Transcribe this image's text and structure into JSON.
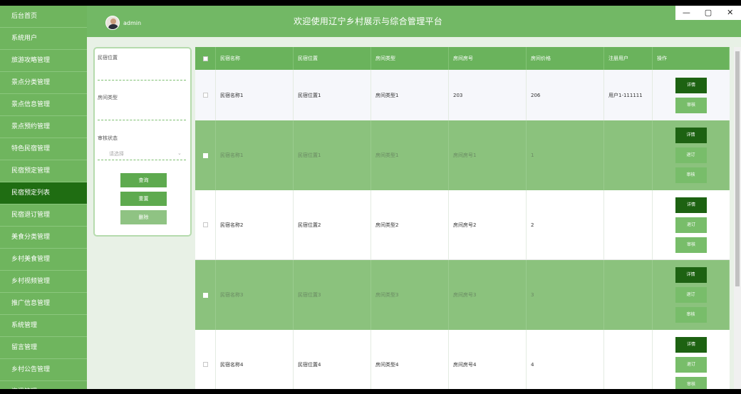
{
  "window_controls": {
    "minimize": "—",
    "maximize": "▢",
    "close": "✕"
  },
  "sidebar": {
    "items": [
      {
        "label": "后台首页"
      },
      {
        "label": "系统用户"
      },
      {
        "label": "旅游攻略管理"
      },
      {
        "label": "景点分类管理"
      },
      {
        "label": "景点信息管理"
      },
      {
        "label": "景点预约管理"
      },
      {
        "label": "特色民宿管理"
      },
      {
        "label": "民宿预定管理"
      },
      {
        "label": "民宿预定列表"
      },
      {
        "label": "民宿退订管理"
      },
      {
        "label": "美食分类管理"
      },
      {
        "label": "乡村美食管理"
      },
      {
        "label": "乡村视频管理"
      },
      {
        "label": "推广信息管理"
      },
      {
        "label": "系统管理"
      },
      {
        "label": "留言管理"
      },
      {
        "label": "乡村公告管理"
      },
      {
        "label": "资讯管理"
      }
    ],
    "active_index": 8
  },
  "header": {
    "username": "admin",
    "title": "欢迎使用辽宁乡村展示与综合管理平台"
  },
  "filter": {
    "location_label": "民宿位置",
    "room_type_label": "房间类型",
    "status_label": "审核状态",
    "status_placeholder": "请选择",
    "query_button": "查询",
    "reset_button": "重置",
    "delete_button": "删除"
  },
  "table": {
    "columns": [
      "民宿名称",
      "民宿位置",
      "房间类型",
      "房间房号",
      "房间价格",
      "注册用户",
      "操作"
    ],
    "rows": [
      {
        "name": "民宿名称1",
        "location": "民宿位置1",
        "room_type": "房间类型1",
        "room_no": "203",
        "price": "206",
        "user": "用户1-111111",
        "actions": [
          "详情",
          "审核"
        ]
      },
      {
        "name": "民宿名称1",
        "location": "民宿位置1",
        "room_type": "房间类型1",
        "room_no": "房间房号1",
        "price": "1",
        "user": "",
        "actions": [
          "详情",
          "退订",
          "审核"
        ]
      },
      {
        "name": "民宿名称2",
        "location": "民宿位置2",
        "room_type": "房间类型2",
        "room_no": "房间房号2",
        "price": "2",
        "user": "",
        "actions": [
          "详情",
          "退订",
          "审核"
        ]
      },
      {
        "name": "民宿名称3",
        "location": "民宿位置3",
        "room_type": "房间类型3",
        "room_no": "房间房号3",
        "price": "3",
        "user": "",
        "actions": [
          "详情",
          "退订",
          "审核"
        ]
      },
      {
        "name": "民宿名称4",
        "location": "民宿位置4",
        "room_type": "房间类型4",
        "room_no": "房间房号4",
        "price": "4",
        "user": "",
        "actions": [
          "详情",
          "退订",
          "审核"
        ]
      }
    ]
  },
  "colors": {
    "sidebar": "#6fb55e",
    "active": "#1f6d12",
    "header": "#72b865",
    "row_highlight": "#8bc27d"
  }
}
